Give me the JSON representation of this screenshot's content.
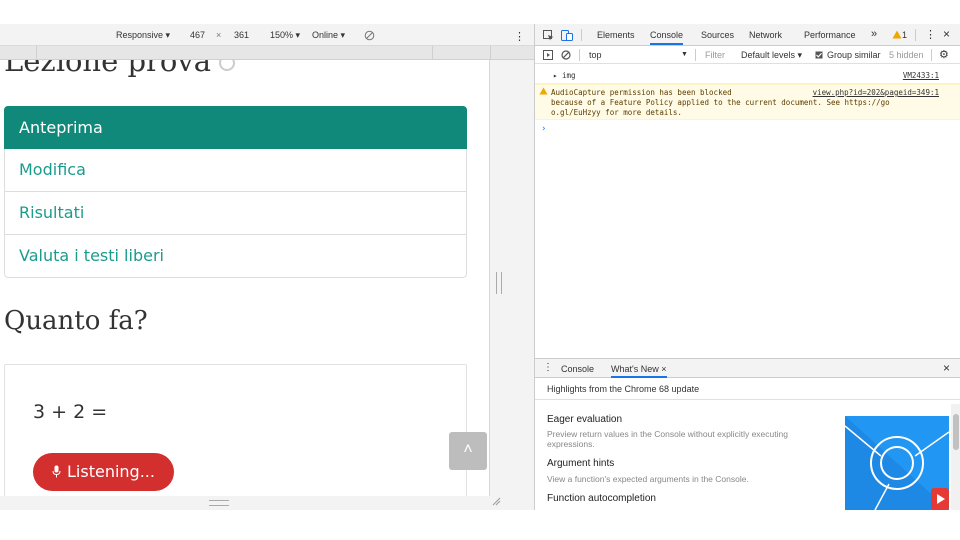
{
  "device_toolbar": {
    "mode": "Responsive ▾",
    "width": "467",
    "times": "×",
    "height": "361",
    "zoom": "150% ▾",
    "network": "Online ▾",
    "more": "⋮"
  },
  "page": {
    "title": "Lezione prova",
    "menu": [
      "Anteprima",
      "Modifica",
      "Risultati",
      "Valuta i testi liberi"
    ],
    "question_heading": "Quanto fa?",
    "question_text": "3 + 2 =",
    "listening_label": "Listening...",
    "scroll_top_glyph": "˄"
  },
  "devtools": {
    "tabs": [
      "Elements",
      "Console",
      "Sources",
      "Network",
      "Performance"
    ],
    "active_tab": "Console",
    "overflow": "»",
    "warning_count": "1",
    "close": "×",
    "context": "top",
    "filter_placeholder": "Filter",
    "levels": "Default levels ▾",
    "group_similar": "Group similar",
    "hidden": "5 hidden",
    "log_img": "▸ img",
    "log_img_source": "VM2433:1",
    "warn_line1": "AudioCapture permission has been blocked",
    "warn_source": "view.php?id=202&pageid=349:1",
    "warn_line2": "because of a Feature Policy applied to the current document. See https://go",
    "warn_line3": "o.gl/EuHzyy for more details.",
    "prompt": "›",
    "drawer_tabs": [
      "Console",
      "What's New ×"
    ],
    "drawer_close": "×",
    "whats_new_subtitle": "Highlights from the Chrome 68 update",
    "whats_new": [
      {
        "title": "Eager evaluation",
        "desc": "Preview return values in the Console without explicitly executing expressions."
      },
      {
        "title": "Argument hints",
        "desc": "View a function's expected arguments in the Console."
      },
      {
        "title": "Function autocompletion",
        "desc": ""
      }
    ]
  },
  "colors": {
    "accent": "#11897a",
    "link": "#1a9c8c",
    "listening": "#d32f2f",
    "devtools_blue": "#1a73e8"
  }
}
